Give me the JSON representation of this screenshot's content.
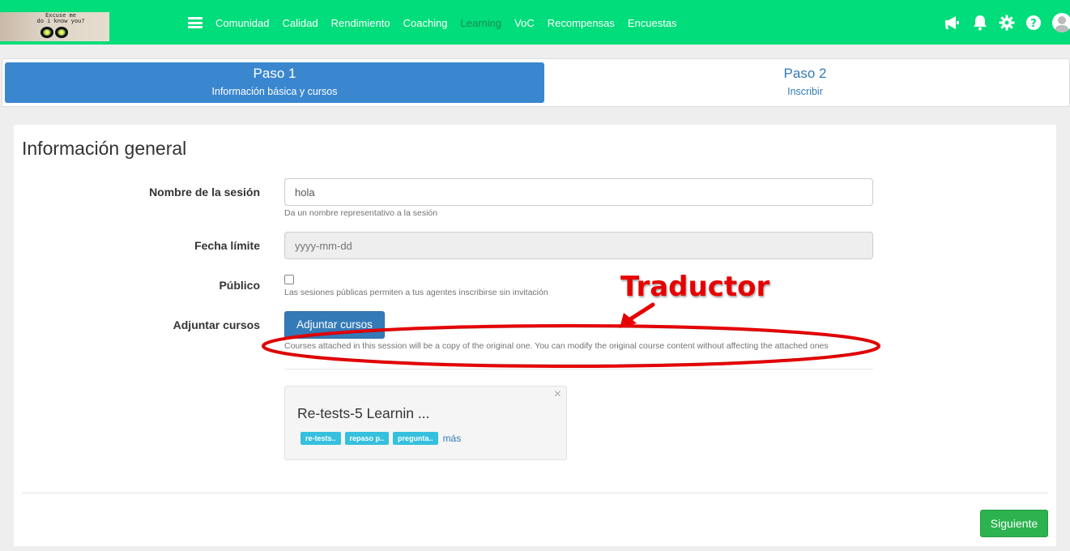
{
  "logo": {
    "line1": "Excuse me",
    "line2": "do i know you?"
  },
  "nav": {
    "items": [
      {
        "label": "Comunidad"
      },
      {
        "label": "Calidad"
      },
      {
        "label": "Rendimiento"
      },
      {
        "label": "Coaching"
      },
      {
        "label": "Learning",
        "active": true
      },
      {
        "label": "VoC"
      },
      {
        "label": "Recompensas"
      },
      {
        "label": "Encuestas"
      }
    ],
    "icons": [
      "megaphone-icon",
      "bell-icon",
      "gear-icon",
      "help-icon",
      "avatar"
    ]
  },
  "stepper": {
    "step1": {
      "title": "Paso 1",
      "subtitle": "Información básica y cursos"
    },
    "step2": {
      "title": "Paso 2",
      "subtitle": "Inscribir"
    }
  },
  "form": {
    "heading": "Información general",
    "session_name": {
      "label": "Nombre de la sesión",
      "value": "hola",
      "help": "Da un nombre representativo a la sesión"
    },
    "deadline": {
      "label": "Fecha límite",
      "placeholder": "yyyy-mm-dd"
    },
    "public": {
      "label": "Público",
      "checked": false,
      "help": "Las sesiones públicas permiten a tus agentes inscribirse sin invitación"
    },
    "attach": {
      "label": "Adjuntar cursos",
      "button": "Adjuntar cursos",
      "help": "Courses attached in this session will be a copy of the original one. You can modify the original course content without affecting the attached ones"
    },
    "course_card": {
      "title": "Re-tests-5 Learnin ...",
      "close": "×",
      "tags": [
        "re-tests..",
        "repaso p..",
        "pregunta.."
      ],
      "more": "más"
    },
    "next_button": "Siguiente"
  },
  "annotation": {
    "text": "Traductor",
    "color": "#e60000"
  },
  "colors": {
    "topbar": "#00dd7a",
    "primary": "#337ab7",
    "success": "#2cb34f",
    "tag": "#35c0dd"
  }
}
